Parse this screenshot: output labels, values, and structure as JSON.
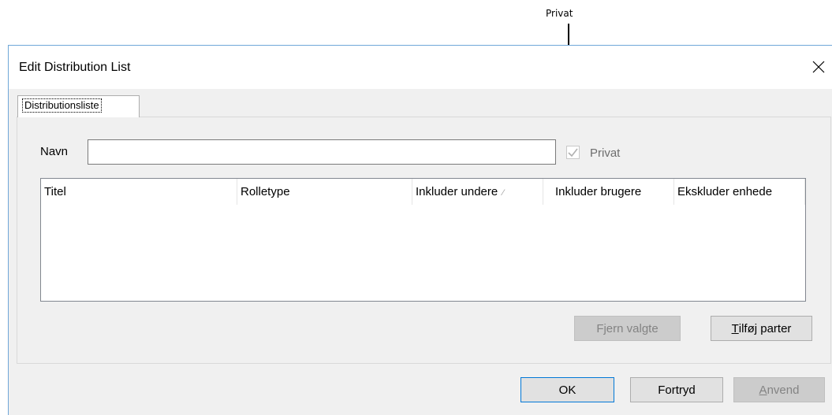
{
  "callout": {
    "label": "Privat"
  },
  "window": {
    "title": "Edit Distribution List",
    "close_icon": "close-icon"
  },
  "tabs": [
    {
      "label": "Distributionsliste",
      "selected": true
    }
  ],
  "form": {
    "name_label": "Navn",
    "name_value": "",
    "private_label": "Privat",
    "private_checked": true,
    "private_enabled": false
  },
  "table": {
    "columns": [
      "Titel",
      "Rolletype",
      "Inkluder undere",
      "Inkluder brugere",
      "Ekskluder enhede"
    ],
    "sort_column": "Inkluder undere",
    "rows": []
  },
  "panel_buttons": {
    "remove_label": "Fjern valgte",
    "add_parts_label": "Tilføj parter",
    "add_parts_mnemonic": "T",
    "add_parts_rest": "ilføj parter"
  },
  "footer_buttons": {
    "ok_label": "OK",
    "cancel_label": "Fortryd",
    "apply_label": "Anvend",
    "apply_mnemonic": "A",
    "apply_rest": "nvend"
  },
  "colors": {
    "dialog_border": "#6fa7d8",
    "dialog_bg": "#f0f0f0",
    "disabled_text": "#838383"
  }
}
